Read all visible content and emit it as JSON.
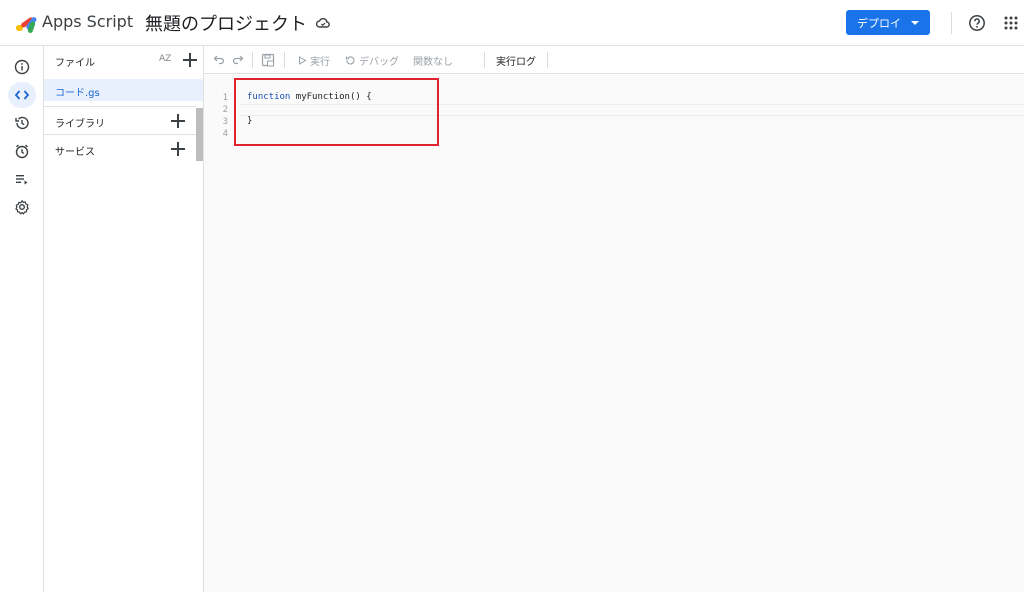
{
  "header": {
    "app_name": "Apps Script",
    "project_title": "無題のプロジェクト",
    "deploy_label": "デプロイ",
    "brand_color": "#1a73e8"
  },
  "rail": {
    "items": [
      {
        "name": "info-icon"
      },
      {
        "name": "code-icon"
      },
      {
        "name": "history-icon"
      },
      {
        "name": "alarm-icon"
      },
      {
        "name": "executions-icon"
      },
      {
        "name": "settings-icon"
      }
    ]
  },
  "files": {
    "header": "ファイル",
    "sort_icon": "AZ",
    "items": [
      {
        "label": "コード.gs"
      }
    ],
    "sections": [
      {
        "label": "ライブラリ"
      },
      {
        "label": "サービス"
      }
    ]
  },
  "toolbar": {
    "run_label": "実行",
    "debug_label": "デバッグ",
    "function_select": "関数なし",
    "log_label": "実行ログ"
  },
  "editor": {
    "line_numbers": [
      "1",
      "2",
      "3",
      "4"
    ],
    "lines": [
      "function myFunction() {",
      "",
      "}",
      ""
    ],
    "keyword": "function",
    "function_text": " myFunction() {"
  }
}
